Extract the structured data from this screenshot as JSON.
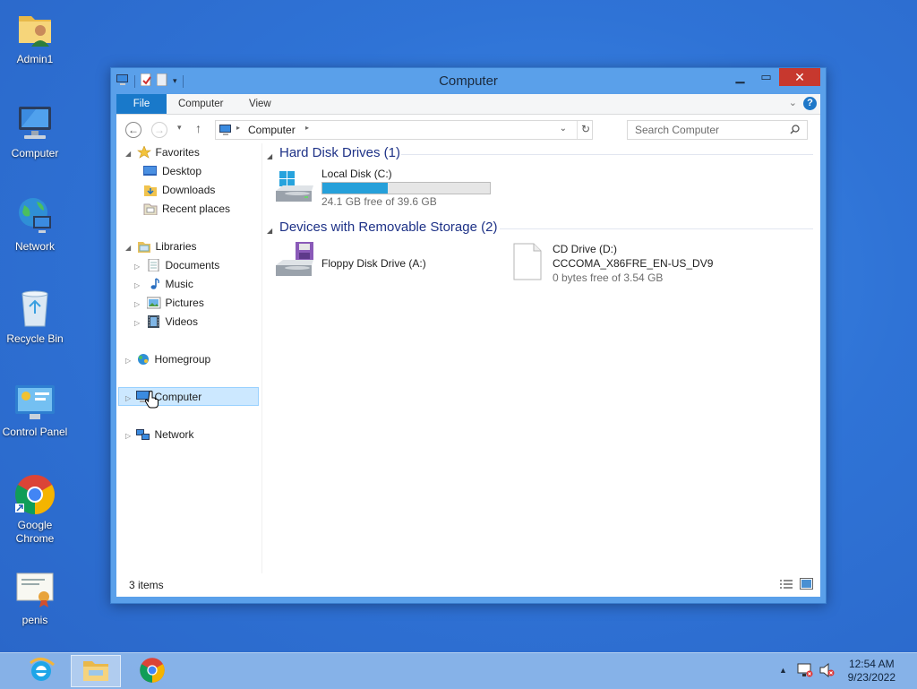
{
  "desktop": {
    "icons": [
      {
        "label": "Admin1"
      },
      {
        "label": "Computer"
      },
      {
        "label": "Network"
      },
      {
        "label": "Recycle Bin"
      },
      {
        "label": "Control Panel"
      },
      {
        "label": "Google\nChrome"
      },
      {
        "label": "penis"
      }
    ]
  },
  "window": {
    "title": "Computer",
    "ribbon": {
      "file": "File",
      "computer": "Computer",
      "view": "View",
      "help": "?"
    },
    "address": {
      "crumb": "Computer",
      "search_placeholder": "Search Computer"
    },
    "nav": {
      "favorites": "Favorites",
      "desktop": "Desktop",
      "downloads": "Downloads",
      "recent": "Recent places",
      "libraries": "Libraries",
      "documents": "Documents",
      "music": "Music",
      "pictures": "Pictures",
      "videos": "Videos",
      "homegroup": "Homegroup",
      "computer": "Computer",
      "network": "Network"
    },
    "content": {
      "hdd_header": "Hard Disk Drives (1)",
      "removable_header": "Devices with Removable Storage (2)",
      "local_disk": {
        "name": "Local Disk (C:)",
        "free": "24.1 GB free of 39.6 GB",
        "used_fraction": 0.39
      },
      "floppy": {
        "name": "Floppy Disk Drive (A:)"
      },
      "cd": {
        "name": "CD Drive (D:)",
        "volume": "CCCOMA_X86FRE_EN-US_DV9",
        "free": "0 bytes free of 3.54 GB"
      }
    },
    "status": {
      "count": "3 items"
    }
  },
  "taskbar": {
    "time": "12:54 AM",
    "date": "9/23/2022"
  },
  "colors": {
    "accent": "#1979ca",
    "close": "#c7382e",
    "header_text": "#1e3287",
    "selection": "#cce8ff"
  }
}
